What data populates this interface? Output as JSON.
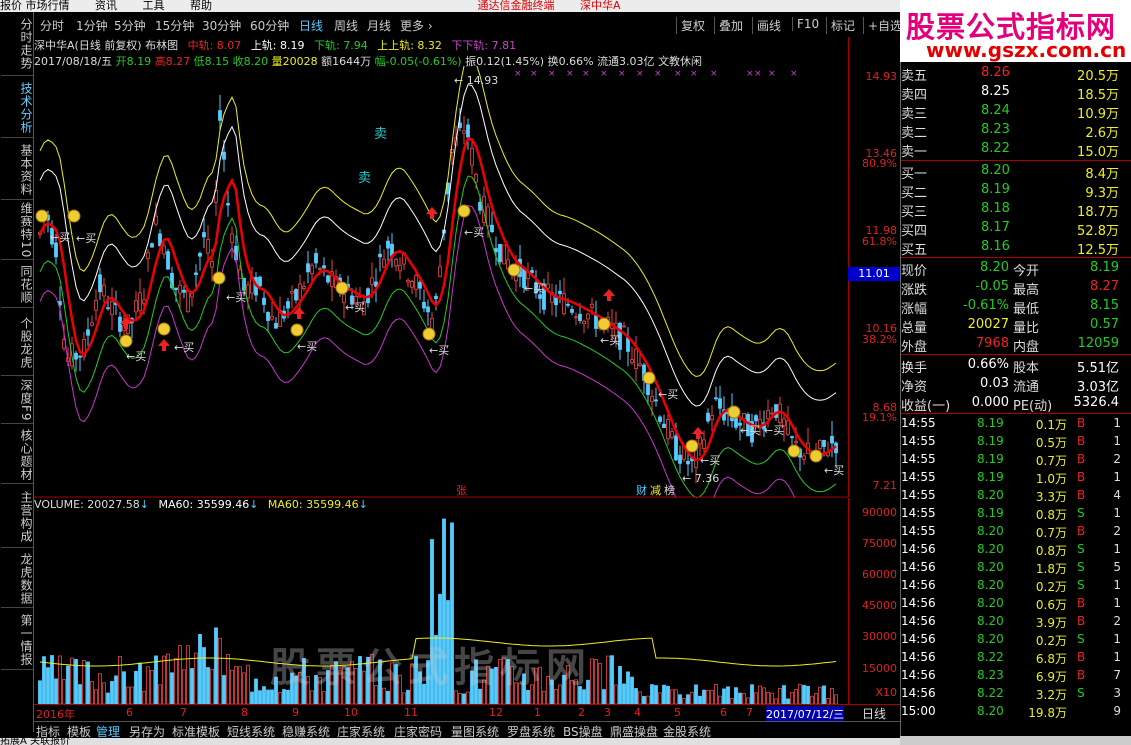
{
  "topbar": {
    "items": [
      "报价 市场行情",
      "资讯",
      "工具",
      "帮助"
    ],
    "center": "通达信金融终端",
    "stock": "深中华A"
  },
  "brand": {
    "name": "股票公式指标网",
    "url": "www.gszx.com.cn"
  },
  "left_tabs": [
    "分时走势",
    "技术分析",
    "基本资料",
    "维赛特10",
    "同花顺",
    "个股龙虎",
    "深度F9",
    "核心题材",
    "主营构成",
    "龙虎数据",
    "第一情报"
  ],
  "period_tabs": [
    "分时",
    "1分钟",
    "5分钟",
    "15分钟",
    "30分钟",
    "60分钟",
    "日线",
    "周线",
    "月线",
    "更多 ›"
  ],
  "period_active": "日线",
  "toolbar": {
    "fuquan": "复权",
    "dieja": "叠加",
    "huaxian": "画线",
    "f10": "F10",
    "biaoji": "标记",
    "zixuan": "+自选"
  },
  "chart_header": {
    "title": "深中华A(日线 前复权) 布林图",
    "mid": "中轨: 8.07",
    "up": "上轨: 8.19",
    "down": "下轨: 7.94",
    "upup": "上上轨: 8.32",
    "downdown": "下下轨: 7.81"
  },
  "ohlc_line": {
    "date": "2017/08/18/五",
    "open": "开8.19",
    "high": "高8.27",
    "low": "低8.15",
    "close": "收8.20",
    "vol": "量20028",
    "amt": "额1644万",
    "chg": "幅-0.05(-0.61%)",
    "amp": "振0.12(1.45%)",
    "turn": "换0.66%",
    "float": "流通3.03亿",
    "ind": "文教休闲"
  },
  "price_axis": [
    "14.93",
    "13.46",
    "80.9%",
    "11.98",
    "61.8%",
    "10.16",
    "38.2%",
    "8.68",
    "19.1%",
    "7.21"
  ],
  "current_price_tag": "11.01",
  "chart_labels": {
    "high": "14.93",
    "low": "7.36",
    "sell": "卖",
    "buy": "买",
    "zhang": "张",
    "cai": "财",
    "jian": "减",
    "jie": "榜"
  },
  "volume": {
    "label": "VOLUME: 20027.58",
    "ma1": "MA60: 35599.46",
    "ma2": "MA60: 35599.46",
    "axis": [
      "90000",
      "75000",
      "60000",
      "45000",
      "30000",
      "15000",
      "X10"
    ]
  },
  "watermark": "股票公式指标网",
  "dates": [
    "2016年",
    "6",
    "7",
    "8",
    "9",
    "10",
    "11",
    "12",
    "1",
    "2",
    "3",
    "4",
    "5",
    "6",
    "7",
    "2017/07/12/三"
  ],
  "date_right": "日线",
  "bottom_tabs": [
    "指标",
    "模板",
    "管理",
    "另存为",
    "标准模板",
    "短线系统",
    "稳赚系统",
    "庄家系统",
    "庄家密码",
    "量图系统",
    "罗盘系统",
    "BS操盘",
    "鼎盛操盘",
    "金股系统"
  ],
  "bottom_active": "管理",
  "statusbar": "拓展A  关联报价",
  "quote": {
    "sells": [
      {
        "l": "卖五",
        "p": "8.26",
        "v": "20.5万"
      },
      {
        "l": "卖四",
        "p": "8.25",
        "v": "18.5万"
      },
      {
        "l": "卖三",
        "p": "8.24",
        "v": "10.9万"
      },
      {
        "l": "卖二",
        "p": "8.23",
        "v": "2.6万"
      },
      {
        "l": "卖一",
        "p": "8.22",
        "v": "15.0万"
      }
    ],
    "buys": [
      {
        "l": "买一",
        "p": "8.20",
        "v": "8.4万"
      },
      {
        "l": "买二",
        "p": "8.19",
        "v": "9.3万"
      },
      {
        "l": "买三",
        "p": "8.18",
        "v": "18.7万"
      },
      {
        "l": "买四",
        "p": "8.17",
        "v": "52.8万"
      },
      {
        "l": "买五",
        "p": "8.16",
        "v": "12.5万"
      }
    ],
    "stats": [
      {
        "l1": "现价",
        "v1": "8.20",
        "l2": "今开",
        "v2": "8.19"
      },
      {
        "l1": "涨跌",
        "v1": "-0.05",
        "l2": "最高",
        "v2": "8.27"
      },
      {
        "l1": "涨幅",
        "v1": "-0.61%",
        "l2": "最低",
        "v2": "8.15"
      },
      {
        "l1": "总量",
        "v1": "20027",
        "l2": "量比",
        "v2": "0.57"
      },
      {
        "l1": "外盘",
        "v1": "7968",
        "l2": "内盘",
        "v2": "12059"
      }
    ],
    "stats2": [
      {
        "l1": "换手",
        "v1": "0.66%",
        "l2": "股本",
        "v2": "5.51亿"
      },
      {
        "l1": "净资",
        "v1": "0.03",
        "l2": "流通",
        "v2": "3.03亿"
      },
      {
        "l1": "收益(一)",
        "v1": "0.000",
        "l2": "PE(动)",
        "v2": "5326.4"
      }
    ]
  },
  "ticks": [
    [
      "14:55",
      "8.19",
      "0.1万",
      "B",
      "1"
    ],
    [
      "14:55",
      "8.19",
      "0.5万",
      "B",
      "1"
    ],
    [
      "14:55",
      "8.19",
      "0.7万",
      "B",
      "2"
    ],
    [
      "14:55",
      "8.19",
      "1.0万",
      "B",
      "1"
    ],
    [
      "14:55",
      "8.20",
      "3.3万",
      "B",
      "4"
    ],
    [
      "14:55",
      "8.19",
      "0.8万",
      "S",
      "1"
    ],
    [
      "14:55",
      "8.20",
      "0.7万",
      "B",
      "2"
    ],
    [
      "14:56",
      "8.20",
      "0.8万",
      "S",
      "1"
    ],
    [
      "14:56",
      "8.20",
      "1.8万",
      "S",
      "5"
    ],
    [
      "14:56",
      "8.20",
      "0.2万",
      "S",
      "1"
    ],
    [
      "14:56",
      "8.20",
      "0.6万",
      "B",
      "1"
    ],
    [
      "14:56",
      "8.20",
      "3.9万",
      "B",
      "2"
    ],
    [
      "14:56",
      "8.20",
      "0.2万",
      "S",
      "1"
    ],
    [
      "14:56",
      "8.22",
      "6.8万",
      "B",
      "1"
    ],
    [
      "14:56",
      "8.23",
      "6.9万",
      "B",
      "7"
    ],
    [
      "14:56",
      "8.22",
      "3.2万",
      "S",
      "3"
    ],
    [
      "15:00",
      "8.20",
      "19.8万",
      "",
      "9"
    ]
  ]
}
